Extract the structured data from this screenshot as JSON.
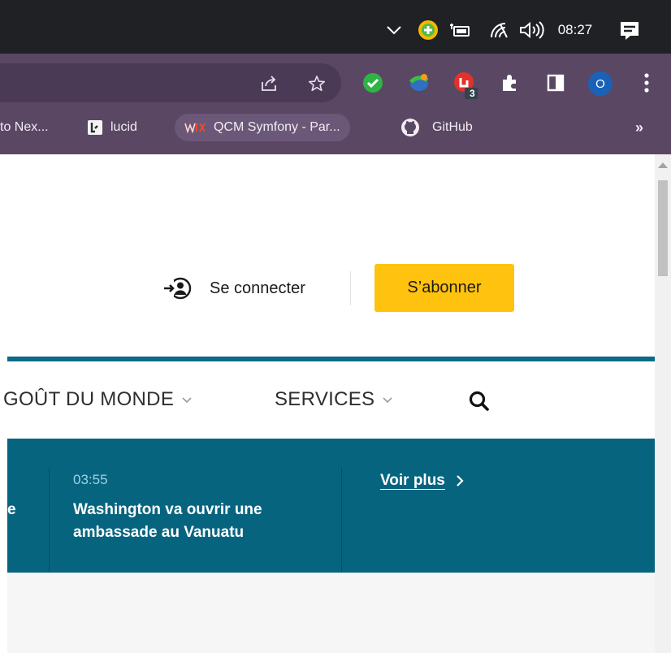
{
  "taskbar": {
    "clock": "08:27"
  },
  "bookmarks": [
    {
      "label": "to Nex..."
    },
    {
      "label": "lucid"
    },
    {
      "label": "QCM Symfony - Par..."
    },
    {
      "label": "GitHub"
    }
  ],
  "bookmarks_overflow": "»",
  "extensions": {
    "badge_count": "3",
    "profile_initial": "O"
  },
  "header": {
    "login_label": "Se connecter",
    "subscribe_label": "S’abonner"
  },
  "nav": {
    "items": [
      {
        "label": "GOÛT DU MONDE"
      },
      {
        "label": "SERVICES"
      }
    ]
  },
  "ticker": {
    "previous_fragment": "e",
    "item": {
      "time": "03:55",
      "title": "Washington va ouvrir une ambassade au Vanuatu"
    },
    "more_label": "Voir plus"
  },
  "colors": {
    "accent_blue": "#07647f",
    "subscribe_yellow": "#ffc20e",
    "chrome_frame": "#5a4764",
    "taskbar": "#202124"
  }
}
